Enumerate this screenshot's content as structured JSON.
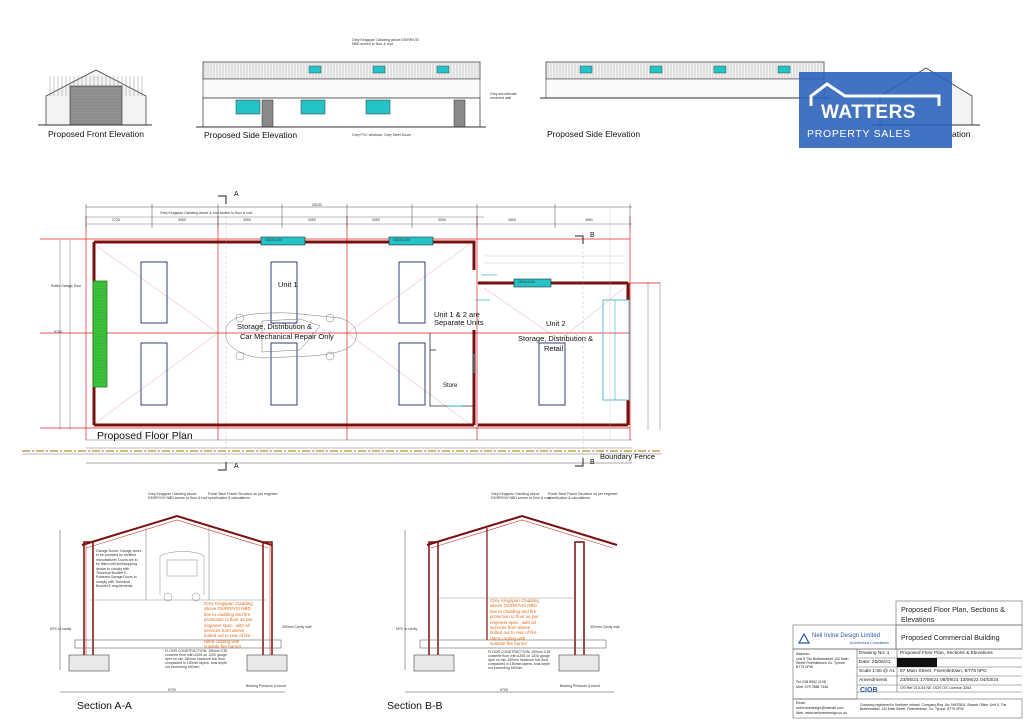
{
  "elevations": {
    "front_label": "Proposed Front Elevation",
    "side_label": "Proposed Side Elevation",
    "side_label_2": "Proposed Side Elevation",
    "rear_label_partial": "ation",
    "cladding_note": "Grey Kingspan Cladding above DS/RR/VS/ NBD screen to floor & roof",
    "render_note": "Grey smoothcast rendered wall",
    "window_note": "Grey PVC windows, Grey Steel Doors"
  },
  "logo": {
    "line1": "WATTERS",
    "line2": "PROPERTY SALES",
    "color": "#2a5fba"
  },
  "floor_plan": {
    "title": "Proposed Floor Plan",
    "unit1_name": "Unit 1",
    "unit1_use_line1": "Storage, Distribution &",
    "unit1_use_line2": "Car Mechanical Repair Only",
    "divider_note_line1": "Unit 1 & 2 are",
    "divider_note_line2": "Separate Units",
    "store": "Store",
    "unit2_name": "Unit 2",
    "unit2_use_line1": "Storage, Distribution &",
    "unit2_use_line2": "Retail",
    "boundary": "Boundary Fence",
    "section_a": "A",
    "section_b": "B",
    "roller_door_note": "Roller Garage Door",
    "gutter_note": "Grey Kingspan Cladding above & roof screen to floor & roof",
    "dimensions_top": [
      "2725",
      "3050",
      "3050",
      "3050",
      "3050",
      "3050",
      "2800",
      "4960"
    ],
    "overall_length": "25100",
    "width": "9700",
    "window_dims": [
      "1800x1100",
      "1800x1100",
      "1800x1100"
    ]
  },
  "sections": {
    "a_title": "Section A-A",
    "b_title": "Section B-B",
    "roof_note": "Grey Kingspan Cladding above DS/RR/VS/ NBD screen to floor & roof",
    "frame_note": "Portal Steel Frame Structure as per engineer specification & calculations",
    "garage_doors_note": "Garage Doors: Garage doors to be provided by certified manufacturer. Doors are to be fitted with limit/stopping device to comply with Technical Booklet E. Powered Garage Doors to comply with Technical Booklet E requirements.",
    "orange_note": "Grey Kingspan Cladding above DS/RR/VS/ NBD line to cladding and fire protection to floor as per engineer spec., with all services from above bolted out to rear of fire rated coating with suitable fire barrier",
    "floor_construction": "FLOOR CONSTRUCTION: 150mm C35 concrete floor with A393 on 1200 gauge dpm on min 150mm hardcore sub-floor compacted in 150mm layers, total depth not exceeding 600mm",
    "cavity_wall": "300mm Cavity wall",
    "dpc_note": "DPC to cavity",
    "foundation": "Bearing Pressure & found",
    "dim_span": "9700"
  },
  "title_block": {
    "drawing_title_line1": "Proposed Floor Plan, Sections &",
    "drawing_title_line2": "Elevations",
    "project": "Proposed Commercial Building",
    "company": "Neil Irvine Design Limited",
    "company_sub": "Architectural Consultants",
    "drawing_no_label": "Drawing No: 1",
    "date_label": "Date: 25/06/21",
    "scale_label": "Scale 1:50 @ A1",
    "amendments_label": "Amendments",
    "drawing_desc": "Proposed Floor Plan, Sections & Elevations",
    "address": "87 Main Street, Fivemiletown, BT75 0PG",
    "amendment_dates": "23/06/21 17/08/21 08/09/21 13/06/22 04/03/24",
    "os_ref": "OS Ref 213-04 NE OCR OS Licence 3264",
    "ciob": "CIOB",
    "address_block_label": "Address:",
    "address_block": "Unit 5 The Buttermarket 132 Main Street Fivemiletown Co. Tyrone BT75 0PW",
    "tel": "Tel: 028 8952 2108",
    "mob": "Mob: 079 7888 7346",
    "email_label": "Email:",
    "email": "neil.irvinedesign@hotmail.com",
    "web": "Web: www.neilirvinedesign.co.uk",
    "footer": "Company registered in Northern Ireland. Company Reg. No. NI670811. Branch Office: Unit 5, The Buttermarket, 132 Main Street, Fivemiletown, Co. Tyrone, BT75 0PW",
    "redaction_color": "#111111"
  }
}
